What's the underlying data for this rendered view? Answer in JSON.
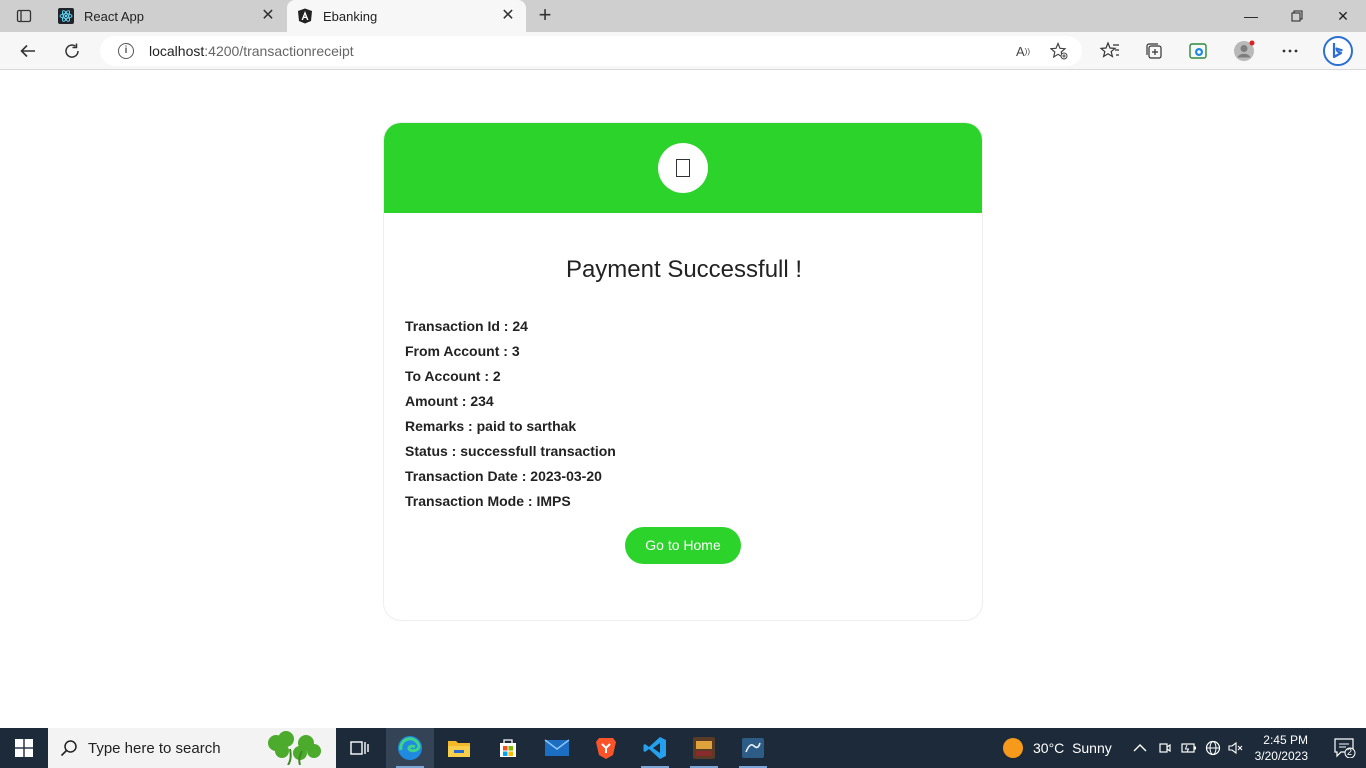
{
  "browser": {
    "tabs": [
      {
        "title": "React App",
        "active": false,
        "icon": "react-icon"
      },
      {
        "title": "Ebanking",
        "active": true,
        "icon": "angular-icon"
      }
    ],
    "url": {
      "host": "localhost",
      "path": ":4200/transactionreceipt"
    }
  },
  "receipt": {
    "title": "Payment Successfull !",
    "icon": "success-check-icon",
    "header_color": "#2bd32b",
    "details": [
      {
        "label": "Transaction Id",
        "value": "24"
      },
      {
        "label": "From Account",
        "value": "3"
      },
      {
        "label": "To Account",
        "value": "2"
      },
      {
        "label": "Amount",
        "value": "234"
      },
      {
        "label": "Remarks",
        "value": "paid to sarthak"
      },
      {
        "label": "Status",
        "value": "successfull transaction"
      },
      {
        "label": "Transaction Date",
        "value": "2023-03-20"
      },
      {
        "label": "Transaction Mode",
        "value": "IMPS"
      }
    ],
    "button_label": "Go to Home"
  },
  "taskbar": {
    "search_placeholder": "Type here to search",
    "weather": {
      "temp": "30°C",
      "condition": "Sunny"
    },
    "time": "2:45 PM",
    "date": "3/20/2023",
    "notification_count": "2"
  }
}
